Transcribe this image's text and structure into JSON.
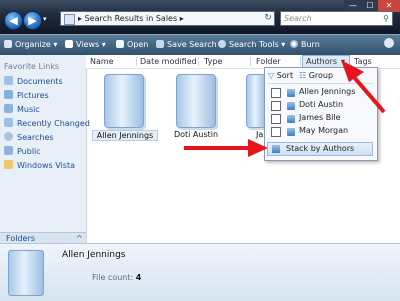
{
  "window": {
    "minimize": "—",
    "maximize": "☐",
    "close": "✕"
  },
  "address": {
    "path_sep": "▸",
    "path": "Search Results in Sales",
    "trail": "▸",
    "search_placeholder": "Search"
  },
  "toolbar": {
    "organize": "Organize",
    "views": "Views",
    "open": "Open",
    "save_search": "Save Search",
    "search_tools": "Search Tools",
    "burn": "Burn",
    "dropdown_caret": "▾"
  },
  "sidebar": {
    "heading": "Favorite Links",
    "items": [
      {
        "label": "Documents",
        "icon": "documents-icon"
      },
      {
        "label": "Pictures",
        "icon": "pictures-icon"
      },
      {
        "label": "Music",
        "icon": "music-icon"
      },
      {
        "label": "Recently Changed",
        "icon": "recent-icon"
      },
      {
        "label": "Searches",
        "icon": "searches-icon"
      },
      {
        "label": "Public",
        "icon": "public-icon"
      },
      {
        "label": "Windows Vista",
        "icon": "folder-icon"
      }
    ],
    "folders": "Folders",
    "folders_caret": "^"
  },
  "columns": [
    "Name",
    "Date modified",
    "Type",
    "Folder",
    "Authors",
    "Tags"
  ],
  "stacks": [
    "Allen Jennings",
    "Doti Austin",
    "Ja"
  ],
  "dropdown": {
    "sort": "Sort",
    "group": "Group",
    "authors": [
      "Allen Jennings",
      "Doti Austin",
      "James Bile",
      "May Morgan"
    ],
    "stack_by": "Stack by Authors"
  },
  "details": {
    "name": "Allen Jennings",
    "file_count_label": "File count:",
    "file_count_value": "4"
  },
  "colors": {
    "accent_red": "#e8141b",
    "link_blue": "#1a4f9a"
  }
}
